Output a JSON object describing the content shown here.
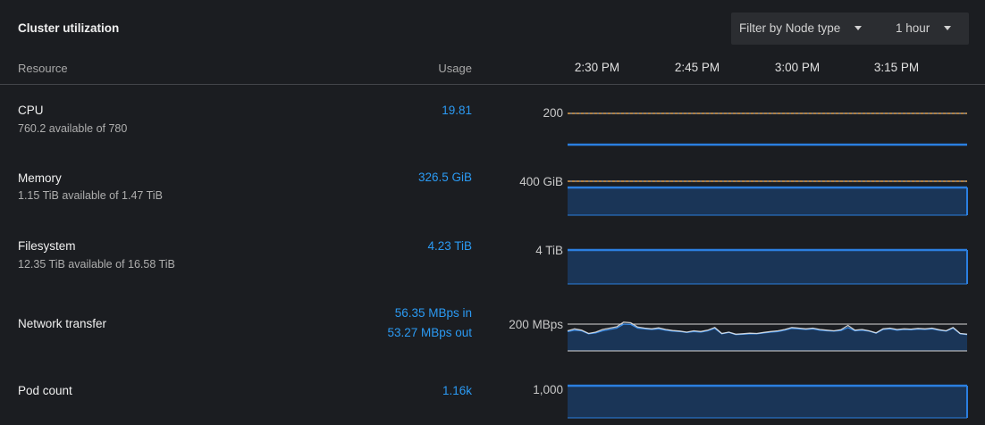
{
  "card": {
    "title": "Cluster utilization",
    "filter_node_type": "Filter by Node type",
    "time_range": "1 hour"
  },
  "table": {
    "col_resource": "Resource",
    "col_usage": "Usage",
    "time_ticks": [
      "2:30 PM",
      "2:45 PM",
      "3:00 PM",
      "3:15 PM"
    ]
  },
  "resources": [
    {
      "name": "CPU",
      "available": "760.2 available of 780",
      "usage": "19.81",
      "axis_max": "200",
      "limit_line": true,
      "chart_data": {
        "type": "area",
        "ylim": [
          0,
          200
        ],
        "y_max_label": "200",
        "values": [
          19.8,
          19.7,
          19.9,
          19.8,
          19.6,
          19.8,
          19.9,
          19.7,
          19.8,
          19.6,
          19.8,
          19.81
        ]
      }
    },
    {
      "name": "Memory",
      "available": "1.15 TiB available of 1.47 TiB",
      "usage": "326.5 GiB",
      "axis_max": "400 GiB",
      "limit_line": true,
      "chart_data": {
        "type": "area",
        "ylim": [
          0,
          400
        ],
        "unit": "GiB",
        "y_max_label": "400 GiB",
        "values": [
          326.5,
          326.5,
          326.5,
          326.5,
          326.5,
          326.5,
          326.5,
          326.5,
          326.5,
          326.5,
          326.5,
          326.5
        ]
      }
    },
    {
      "name": "Filesystem",
      "available": "12.35 TiB available of 16.58 TiB",
      "usage": "4.23 TiB",
      "axis_max": "4 TiB",
      "limit_line": false,
      "chart_data": {
        "type": "area",
        "ylim": [
          0,
          4
        ],
        "unit": "TiB",
        "y_max_label": "4 TiB",
        "values": [
          4.23,
          4.23,
          4.23,
          4.23,
          4.23,
          4.23,
          4.23,
          4.23,
          4.23,
          4.23,
          4.23,
          4.23
        ]
      }
    },
    {
      "name": "Network transfer",
      "available": "",
      "usage_in": "56.35 MBps in",
      "usage_out": "53.27 MBps out",
      "axis_max": "200 MBps",
      "limit_line": false,
      "chart_data": {
        "type": "area",
        "ylim": [
          0,
          200
        ],
        "unit": "MBps",
        "y_max_label": "200 MBps",
        "series": [
          {
            "name": "in",
            "values": [
              150,
              165,
              155,
              130,
              140,
              160,
              170,
              180,
              215,
              210,
              178,
              170,
              165,
              172,
              160,
              152,
              148,
              140,
              150,
              145,
              155,
              175,
              130,
              140,
              125,
              128,
              132,
              130,
              138,
              145,
              150,
              160,
              175,
              170,
              165,
              170,
              160,
              155,
              150,
              158,
              190,
              155,
              160,
              150,
              135,
              165,
              170,
              160,
              165,
              163,
              168,
              165,
              170,
              158,
              150,
              175,
              130,
              125
            ]
          },
          {
            "name": "out",
            "values": [
              145,
              155,
              150,
              128,
              135,
              150,
              160,
              170,
              200,
              198,
              170,
              165,
              160,
              165,
              155,
              148,
              145,
              138,
              145,
              140,
              150,
              168,
              128,
              138,
              122,
              125,
              128,
              128,
              135,
              140,
              145,
              155,
              168,
              165,
              160,
              165,
              155,
              150,
              148,
              152,
              175,
              150,
              155,
              148,
              132,
              160,
              165,
              155,
              160,
              158,
              163,
              160,
              165,
              155,
              148,
              170,
              128,
              122
            ]
          }
        ]
      }
    },
    {
      "name": "Pod count",
      "available": "",
      "usage": "1.16k",
      "axis_max": "1,000",
      "limit_line": false,
      "chart_data": {
        "type": "area",
        "ylim": [
          0,
          1000
        ],
        "y_max_label": "1,000",
        "values": [
          1160,
          1160,
          1160,
          1160,
          1160,
          1160,
          1160,
          1160,
          1160,
          1160,
          1160,
          1160
        ]
      }
    }
  ],
  "colors": {
    "line": "#2b7fe0",
    "fill": "#1a3557",
    "limit": "#e0a253",
    "grid": "#d8d8d8",
    "accent": "#2b9af3"
  }
}
